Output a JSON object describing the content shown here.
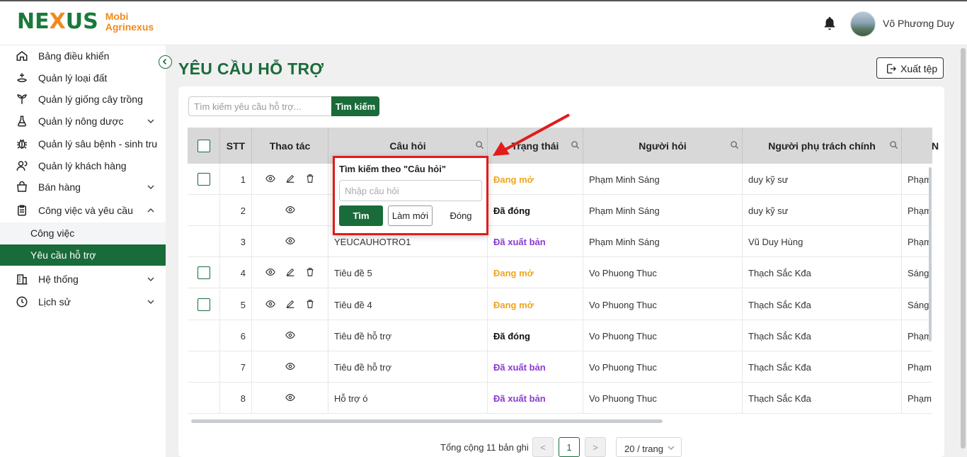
{
  "app": {
    "logo_text": "NEXUS",
    "brand_line1": "Mobi",
    "brand_line2": "Agrinexus",
    "user_name": "Võ Phương Duy",
    "accent_color": "#1a6b3a"
  },
  "sidebar": {
    "items": [
      {
        "label": "Bảng điều khiển",
        "icon": "home-icon"
      },
      {
        "label": "Quản lý loại đất",
        "icon": "land-icon"
      },
      {
        "label": "Quản lý giống cây trồng",
        "icon": "plant-icon"
      },
      {
        "label": "Quản lý nông dược",
        "icon": "flask-icon"
      },
      {
        "label": "Quản lý sâu bệnh - sinh trưởng",
        "icon": "bug-icon"
      },
      {
        "label": "Quản lý khách hàng",
        "icon": "user-icon"
      },
      {
        "label": "Bán hàng",
        "icon": "cart-icon"
      },
      {
        "label": "Công việc và yêu cầu",
        "icon": "clipboard-icon"
      },
      {
        "label": "Hệ thống",
        "icon": "building-icon"
      },
      {
        "label": "Lịch sử",
        "icon": "history-icon"
      }
    ],
    "sub_items": [
      {
        "label": "Công việc"
      },
      {
        "label": "Yêu cầu hỗ trợ"
      }
    ]
  },
  "page": {
    "title": "YÊU CẦU HỖ TRỢ",
    "export_label": "Xuất tệp",
    "search_placeholder": "Tìm kiếm yêu cầu hỗ trợ...",
    "search_button": "Tìm kiếm"
  },
  "table": {
    "columns": [
      "STT",
      "Thao tác",
      "Câu hỏi",
      "Trạng thái",
      "Người hỏi",
      "Người phụ trách chính",
      "N"
    ],
    "rows": [
      {
        "stt": "1",
        "question": "",
        "status": "Đang mở",
        "asker": "Phạm Minh Sáng",
        "owner": "duy kỹ sư",
        "extra": "Phạm"
      },
      {
        "stt": "2",
        "question": "",
        "status": "Đã đóng",
        "asker": "Phạm Minh Sáng",
        "owner": "duy kỹ sư",
        "extra": "Phạm"
      },
      {
        "stt": "3",
        "question": "YEUCAUHOTRO1",
        "status": "Đã xuất bản",
        "asker": "Phạm Minh Sáng",
        "owner": "Vũ Duy Hùng",
        "extra": "Phạm"
      },
      {
        "stt": "4",
        "question": "Tiêu đề 5",
        "status": "Đang mở",
        "asker": "Vo Phuong Thuc",
        "owner": "Thạch Sắc Kđa",
        "extra": "Sáng"
      },
      {
        "stt": "5",
        "question": "Tiêu đề 4",
        "status": "Đang mở",
        "asker": "Vo Phuong Thuc",
        "owner": "Thạch Sắc Kđa",
        "extra": "Sáng"
      },
      {
        "stt": "6",
        "question": "Tiêu đề hỗ trợ",
        "status": "Đã đóng",
        "asker": "Vo Phuong Thuc",
        "owner": "Thạch Sắc Kđa",
        "extra": "Phạm"
      },
      {
        "stt": "7",
        "question": "Tiêu đề hỗ trợ",
        "status": "Đã xuất bản",
        "asker": "Vo Phuong Thuc",
        "owner": "Thạch Sắc Kđa",
        "extra": "Phạm"
      },
      {
        "stt": "8",
        "question": "Hỗ trợ ó",
        "status": "Đã xuất bản",
        "asker": "Vo Phuong Thuc",
        "owner": "Thạch Sắc Kđa",
        "extra": "Phạm"
      }
    ],
    "status_colors": {
      "Đang mở": "#f0a51c",
      "Đã đóng": "#111111",
      "Đã xuất bản": "#8a3ad1"
    }
  },
  "pagination": {
    "total_text": "Tổng cộng 11 bản ghi",
    "prev": "<",
    "current": "1",
    "next": ">",
    "page_size": "20 / trang"
  },
  "popup": {
    "title": "Tìm kiếm theo \"Câu hỏi\"",
    "placeholder": "Nhập câu hỏi",
    "find_label": "Tìm",
    "reset_label": "Làm mới",
    "close_label": "Đóng"
  }
}
